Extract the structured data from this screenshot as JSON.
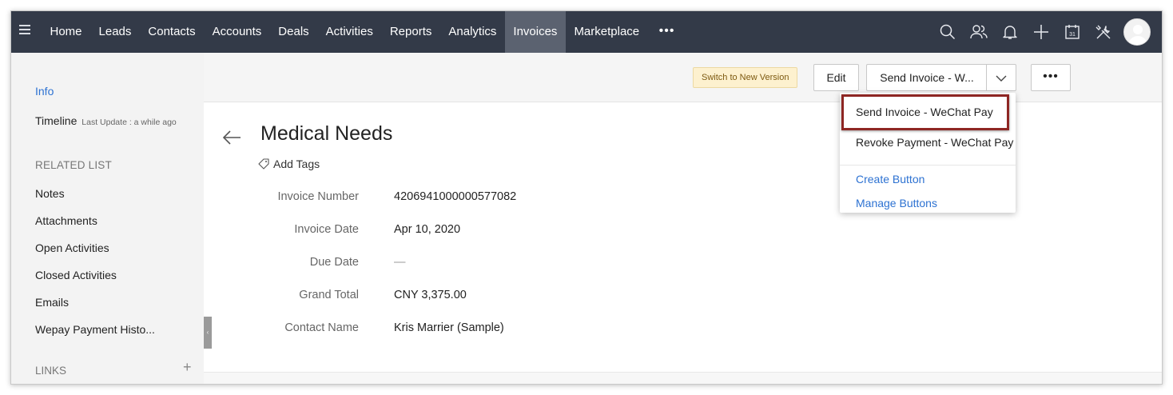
{
  "nav": {
    "items": [
      {
        "label": "Home",
        "active": false
      },
      {
        "label": "Leads",
        "active": false
      },
      {
        "label": "Contacts",
        "active": false
      },
      {
        "label": "Accounts",
        "active": false
      },
      {
        "label": "Deals",
        "active": false
      },
      {
        "label": "Activities",
        "active": false
      },
      {
        "label": "Reports",
        "active": false
      },
      {
        "label": "Analytics",
        "active": false
      },
      {
        "label": "Invoices",
        "active": true
      },
      {
        "label": "Marketplace",
        "active": false
      }
    ],
    "more_label": "•••",
    "icons": [
      "search-icon",
      "contacts-group-icon",
      "bell-icon",
      "plus-icon",
      "calendar-icon",
      "tools-icon"
    ],
    "calendar_day": "31"
  },
  "sidebar": {
    "info_label": "Info",
    "timeline_label": "Timeline",
    "timeline_update": "Last Update : a while ago",
    "related_heading": "RELATED LIST",
    "items": [
      {
        "label": "Notes"
      },
      {
        "label": "Attachments"
      },
      {
        "label": "Open Activities"
      },
      {
        "label": "Closed Activities"
      },
      {
        "label": "Emails"
      },
      {
        "label": "Wepay Payment Histo..."
      }
    ],
    "links_heading": "LINKS",
    "links_add": "+",
    "collapse_glyph": "‹"
  },
  "actions": {
    "switch_label": "Switch to New Version",
    "edit_label": "Edit",
    "send_label": "Send Invoice - W...",
    "more_label": "•••"
  },
  "record": {
    "title": "Medical Needs",
    "add_tags": "Add Tags",
    "fields": [
      {
        "label": "Invoice Number",
        "value": "4206941000000577082",
        "muted": false
      },
      {
        "label": "Invoice Date",
        "value": "Apr 10, 2020",
        "muted": false
      },
      {
        "label": "Due Date",
        "value": "—",
        "muted": true
      },
      {
        "label": "Grand Total",
        "value": "CNY 3,375.00",
        "muted": false
      },
      {
        "label": "Contact Name",
        "value": "Kris Marrier (Sample)",
        "muted": false
      }
    ]
  },
  "dropdown": {
    "items": [
      "Send Invoice - WeChat Pay",
      "Revoke Payment - WeChat Pay"
    ],
    "links": [
      "Create Button",
      "Manage Buttons"
    ]
  },
  "colors": {
    "topbar": "#333a48",
    "active_tab": "#5b6270",
    "link_blue": "#2d72d2",
    "highlight_border": "#8e2623",
    "switch_bg": "#fdf1cf"
  }
}
